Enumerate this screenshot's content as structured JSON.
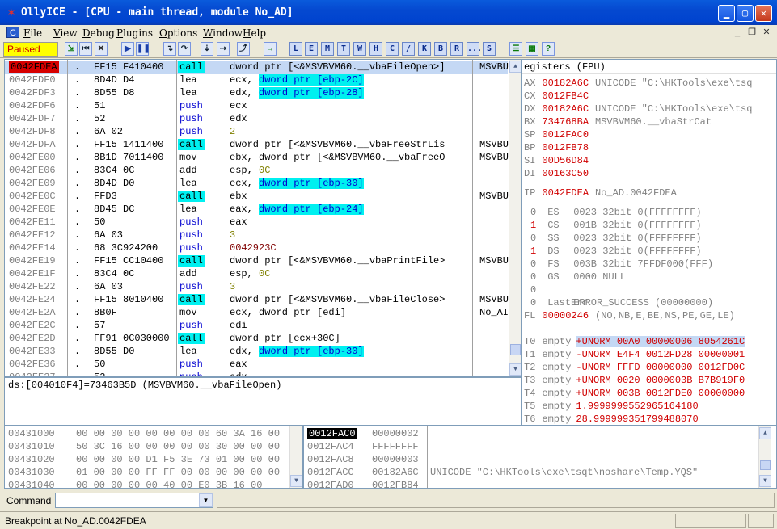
{
  "window": {
    "title": "OllyICE - [CPU - main thread, module No_AD]"
  },
  "menu": [
    "File",
    "View",
    "Debug",
    "Plugins",
    "Options",
    "Window",
    "Help"
  ],
  "toolbar": {
    "status": "Paused",
    "letters": [
      "L",
      "E",
      "M",
      "T",
      "W",
      "H",
      "C",
      "/",
      "K",
      "B",
      "R",
      "...",
      "S"
    ]
  },
  "disasm": [
    {
      "addr": "0042FDEA",
      "hex": "FF15 F410400",
      "mn": "call",
      "ops": [
        {
          "t": "dword ptr [<&MSVBVM60.__vbaFileOpen>]"
        }
      ],
      "cm": "MSVBU",
      "sel": true,
      "cur": true
    },
    {
      "addr": "0042FDF0",
      "hex": "8D4D D4",
      "mn": "lea",
      "ops": [
        {
          "t": "ecx, "
        },
        {
          "t": "dword ptr [ebp-2C]",
          "c": "mem"
        }
      ]
    },
    {
      "addr": "0042FDF3",
      "hex": "8D55 D8",
      "mn": "lea",
      "ops": [
        {
          "t": "edx, "
        },
        {
          "t": "dword ptr [ebp-28]",
          "c": "mem"
        }
      ]
    },
    {
      "addr": "0042FDF6",
      "hex": "51",
      "mn": "push",
      "ops": [
        {
          "t": "ecx"
        }
      ]
    },
    {
      "addr": "0042FDF7",
      "hex": "52",
      "mn": "push",
      "ops": [
        {
          "t": "edx"
        }
      ]
    },
    {
      "addr": "0042FDF8",
      "hex": "6A 02",
      "mn": "push",
      "ops": [
        {
          "t": "2",
          "c": "imm"
        }
      ]
    },
    {
      "addr": "0042FDFA",
      "hex": "FF15 1411400",
      "mn": "call",
      "ops": [
        {
          "t": "dword ptr [<&MSVBVM60.__vbaFreeStrLis"
        }
      ],
      "cm": "MSVBU"
    },
    {
      "addr": "0042FE00",
      "hex": "8B1D 7011400",
      "mn": "mov",
      "ops": [
        {
          "t": "ebx, dword ptr [<&MSVBVM60.__vbaFreeO"
        }
      ],
      "cm": "MSVBU"
    },
    {
      "addr": "0042FE06",
      "hex": "83C4 0C",
      "mn": "add",
      "ops": [
        {
          "t": "esp, "
        },
        {
          "t": "0C",
          "c": "imm"
        }
      ]
    },
    {
      "addr": "0042FE09",
      "hex": "8D4D D0",
      "mn": "lea",
      "ops": [
        {
          "t": "ecx, "
        },
        {
          "t": "dword ptr [ebp-30]",
          "c": "mem"
        }
      ]
    },
    {
      "addr": "0042FE0C",
      "hex": "FFD3",
      "mn": "call",
      "ops": [
        {
          "t": "ebx"
        }
      ],
      "cm": "MSVBU"
    },
    {
      "addr": "0042FE0E",
      "hex": "8D45 DC",
      "mn": "lea",
      "ops": [
        {
          "t": "eax, "
        },
        {
          "t": "dword ptr [ebp-24]",
          "c": "mem"
        }
      ]
    },
    {
      "addr": "0042FE11",
      "hex": "50",
      "mn": "push",
      "ops": [
        {
          "t": "eax"
        }
      ]
    },
    {
      "addr": "0042FE12",
      "hex": "6A 03",
      "mn": "push",
      "ops": [
        {
          "t": "3",
          "c": "imm"
        }
      ]
    },
    {
      "addr": "0042FE14",
      "hex": "68 3C924200",
      "mn": "push",
      "ops": [
        {
          "t": "0042923C",
          "c": "adr"
        }
      ]
    },
    {
      "addr": "0042FE19",
      "hex": "FF15 CC10400",
      "mn": "call",
      "ops": [
        {
          "t": "dword ptr [<&MSVBVM60.__vbaPrintFile>"
        }
      ],
      "cm": "MSVBU"
    },
    {
      "addr": "0042FE1F",
      "hex": "83C4 0C",
      "mn": "add",
      "ops": [
        {
          "t": "esp, "
        },
        {
          "t": "0C",
          "c": "imm"
        }
      ]
    },
    {
      "addr": "0042FE22",
      "hex": "6A 03",
      "mn": "push",
      "ops": [
        {
          "t": "3",
          "c": "imm"
        }
      ]
    },
    {
      "addr": "0042FE24",
      "hex": "FF15 8010400",
      "mn": "call",
      "ops": [
        {
          "t": "dword ptr [<&MSVBVM60.__vbaFileClose>"
        }
      ],
      "cm": "MSVBU"
    },
    {
      "addr": "0042FE2A",
      "hex": "8B0F",
      "mn": "mov",
      "ops": [
        {
          "t": "ecx, dword ptr [edi]"
        }
      ],
      "cm": "No_AI"
    },
    {
      "addr": "0042FE2C",
      "hex": "57",
      "mn": "push",
      "ops": [
        {
          "t": "edi"
        }
      ]
    },
    {
      "addr": "0042FE2D",
      "hex": "FF91 0C030000",
      "mn": "call",
      "ops": [
        {
          "t": "dword ptr [ecx+30C]"
        }
      ]
    },
    {
      "addr": "0042FE33",
      "hex": "8D55 D0",
      "mn": "lea",
      "ops": [
        {
          "t": "edx, "
        },
        {
          "t": "dword ptr [ebp-30]",
          "c": "mem"
        }
      ]
    },
    {
      "addr": "0042FE36",
      "hex": "50",
      "mn": "push",
      "ops": [
        {
          "t": "eax"
        }
      ]
    },
    {
      "addr": "0042FE37",
      "hex": "52",
      "mn": "push",
      "ops": [
        {
          "t": "edx"
        }
      ]
    }
  ],
  "info": {
    "line": "ds:[004010F4]=73463B5D (MSVBVM60.__vbaFileOpen)"
  },
  "registers": {
    "header": "egisters (FPU)",
    "gp": [
      {
        "n": "AX",
        "v": "00182A6C",
        "t": "UNICODE \"C:\\HKTools\\exe\\tsq"
      },
      {
        "n": "CX",
        "v": "0012FB4C",
        "t": ""
      },
      {
        "n": "DX",
        "v": "00182A6C",
        "t": "UNICODE \"C:\\HKTools\\exe\\tsq"
      },
      {
        "n": "BX",
        "v": "734768BA",
        "t": "MSVBVM60.__vbaStrCat"
      },
      {
        "n": "SP",
        "v": "0012FAC0",
        "t": ""
      },
      {
        "n": "BP",
        "v": "0012FB78",
        "t": ""
      },
      {
        "n": "SI",
        "v": "00D56D84",
        "t": ""
      },
      {
        "n": "DI",
        "v": "00163C50",
        "t": ""
      }
    ],
    "ip": {
      "n": "IP",
      "v": "0042FDEA",
      "t": "No_AD.0042FDEA"
    },
    "segs": [
      {
        "f": "0",
        "n": "ES",
        "t": "0023 32bit 0(FFFFFFFF)",
        "red": false
      },
      {
        "f": "1",
        "n": "CS",
        "t": "001B 32bit 0(FFFFFFFF)",
        "red": true
      },
      {
        "f": "0",
        "n": "SS",
        "t": "0023 32bit 0(FFFFFFFF)",
        "red": false
      },
      {
        "f": "1",
        "n": "DS",
        "t": "0023 32bit 0(FFFFFFFF)",
        "red": true
      },
      {
        "f": "0",
        "n": "FS",
        "t": "003B 32bit 7FFDF000(FFF)",
        "red": false
      },
      {
        "f": "0",
        "n": "GS",
        "t": "0000 NULL",
        "red": false
      },
      {
        "f": "0",
        "n": "",
        "t": "",
        "red": false
      },
      {
        "f": "0",
        "n": "LastErr",
        "t": "ERROR_SUCCESS (00000000)",
        "red": false
      }
    ],
    "fl": {
      "n": "FL",
      "v": "00000246",
      "t": "(NO,NB,E,BE,NS,PE,GE,LE)"
    },
    "fpu": [
      {
        "n": "T0",
        "s": "empty",
        "v": "+UNORM 00A0 00000006 8054261C",
        "hl": true
      },
      {
        "n": "T1",
        "s": "empty",
        "v": "-UNORM E4F4 0012FD28 00000001"
      },
      {
        "n": "T2",
        "s": "empty",
        "v": "-UNORM FFFD 00000000 0012FD0C"
      },
      {
        "n": "T3",
        "s": "empty",
        "v": "+UNORM 0020 0000003B B7B919F0"
      },
      {
        "n": "T4",
        "s": "empty",
        "v": "+UNORM 003B 0012FDE0 00000000"
      },
      {
        "n": "T5",
        "s": "empty",
        "v": "1.9999999552965164180"
      },
      {
        "n": "T6",
        "s": "empty",
        "v": "28.999999351799488070"
      }
    ]
  },
  "dump": [
    {
      "addr": "00431000",
      "hex": "00 00 00 00 00 00 00 00 60 3A 16 00"
    },
    {
      "addr": "00431010",
      "hex": "50 3C 16 00 00 00 00 00 30 00 00 00"
    },
    {
      "addr": "00431020",
      "hex": "00 00 00 00 D1 F5 3E 73 01 00 00 00"
    },
    {
      "addr": "00431030",
      "hex": "01 00 00 00 FF FF 00 00 00 00 00 00"
    },
    {
      "addr": "00431040",
      "hex": "00 00 00 00 00 40 00 E0 3B 16 00"
    }
  ],
  "stack": [
    {
      "addr": "0012FAC0",
      "v": "00000002",
      "t": "",
      "cur": true
    },
    {
      "addr": "0012FAC4",
      "v": "FFFFFFFF",
      "t": ""
    },
    {
      "addr": "0012FAC8",
      "v": "00000003",
      "t": ""
    },
    {
      "addr": "0012FACC",
      "v": "00182A6C",
      "t": "UNICODE \"C:\\HKTools\\exe\\tsqt\\noshare\\Temp.YQS\""
    },
    {
      "addr": "0012FAD0",
      "v": "0012FB84",
      "t": ""
    }
  ],
  "command": {
    "label": "Command",
    "value": ""
  },
  "status": {
    "text": "Breakpoint at No_AD.0042FDEA"
  }
}
